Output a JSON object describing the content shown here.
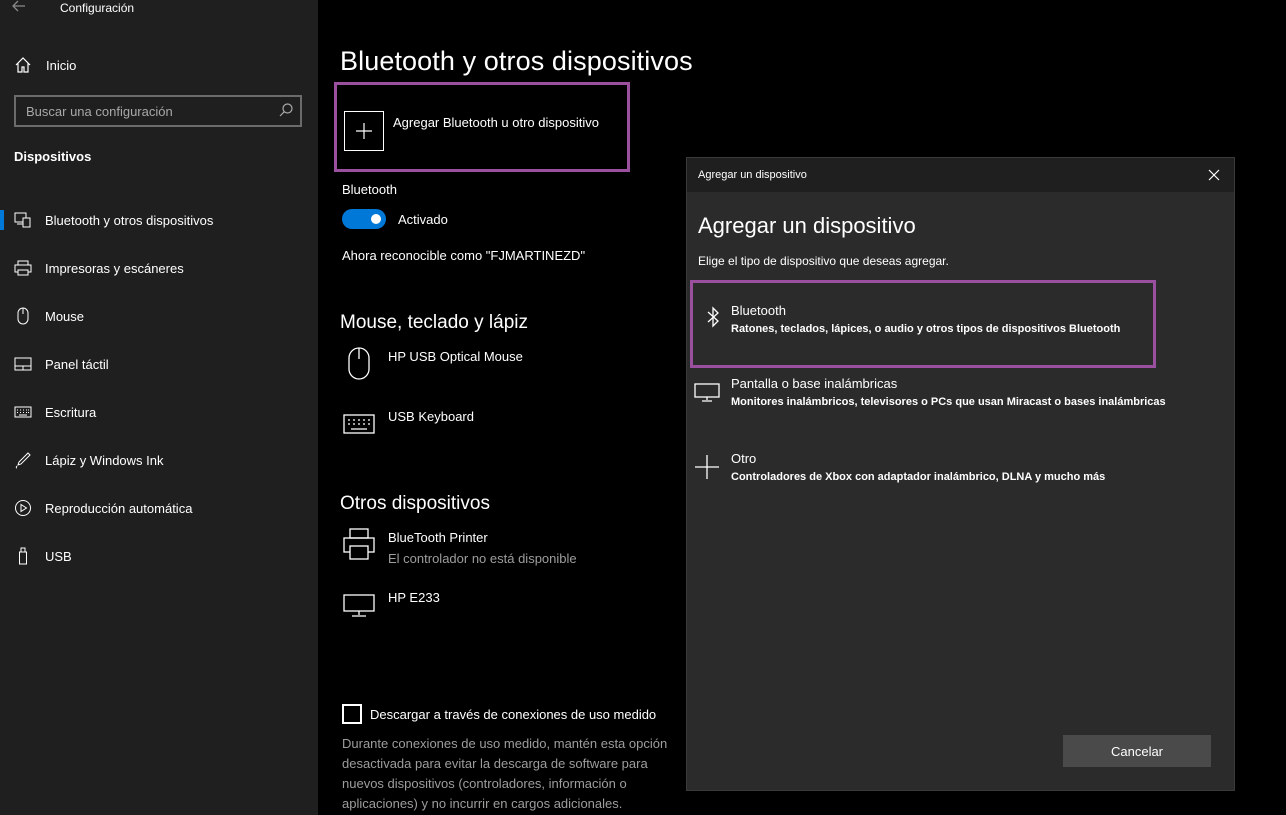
{
  "window": {
    "title": "Configuración"
  },
  "sidebar": {
    "home_label": "Inicio",
    "search_placeholder": "Buscar una configuración",
    "section": "Dispositivos",
    "items": [
      {
        "label": "Bluetooth y otros dispositivos",
        "icon": "bluetooth-devices-icon",
        "active": true
      },
      {
        "label": "Impresoras y escáneres",
        "icon": "printer-icon"
      },
      {
        "label": "Mouse",
        "icon": "mouse-icon"
      },
      {
        "label": "Panel táctil",
        "icon": "touchpad-icon"
      },
      {
        "label": "Escritura",
        "icon": "keyboard-icon"
      },
      {
        "label": "Lápiz y Windows Ink",
        "icon": "pen-icon"
      },
      {
        "label": "Reproducción automática",
        "icon": "autoplay-icon"
      },
      {
        "label": "USB",
        "icon": "usb-icon"
      }
    ]
  },
  "main": {
    "title": "Bluetooth y otros dispositivos",
    "add_device_label": "Agregar Bluetooth u otro dispositivo",
    "bluetooth_label": "Bluetooth",
    "bluetooth_state": "Activado",
    "discoverable_text": "Ahora reconocible como \"FJMARTINEZD\"",
    "mouse_section": {
      "title": "Mouse, teclado y lápiz",
      "devices": [
        {
          "name": "HP USB Optical Mouse",
          "icon": "mouse-icon"
        },
        {
          "name": "USB Keyboard",
          "icon": "keyboard-icon"
        }
      ]
    },
    "other_section": {
      "title": "Otros dispositivos",
      "devices": [
        {
          "name": "BlueTooth Printer",
          "status": "El controlador no está disponible",
          "icon": "printer-icon"
        },
        {
          "name": "HP E233",
          "icon": "monitor-icon"
        }
      ]
    },
    "metered_checkbox_label": "Descargar a través de conexiones de uso medido",
    "metered_description": "Durante conexiones de uso medido, mantén esta opción desactivada para evitar la descarga de software para nuevos dispositivos (controladores, información o aplicaciones) y no incurrir en cargos adicionales."
  },
  "dialog": {
    "window_title": "Agregar un dispositivo",
    "heading": "Agregar un dispositivo",
    "subheading": "Elige el tipo de dispositivo que deseas agregar.",
    "options": [
      {
        "title": "Bluetooth",
        "desc": "Ratones, teclados, lápices, o audio y otros tipos de dispositivos Bluetooth",
        "icon": "bluetooth-icon"
      },
      {
        "title": "Pantalla o base inalámbricas",
        "desc": "Monitores inalámbricos, televisores o PCs que usan Miracast o bases inalámbricas",
        "icon": "display-icon"
      },
      {
        "title": "Otro",
        "desc": "Controladores de Xbox con adaptador inalámbrico, DLNA y mucho más",
        "icon": "plus-icon"
      }
    ],
    "cancel_label": "Cancelar"
  },
  "colors": {
    "accent": "#0078d7",
    "highlight": "#9b4f9f",
    "sidebar_bg": "#1f1f1f",
    "dialog_bg": "#2b2b2b"
  }
}
